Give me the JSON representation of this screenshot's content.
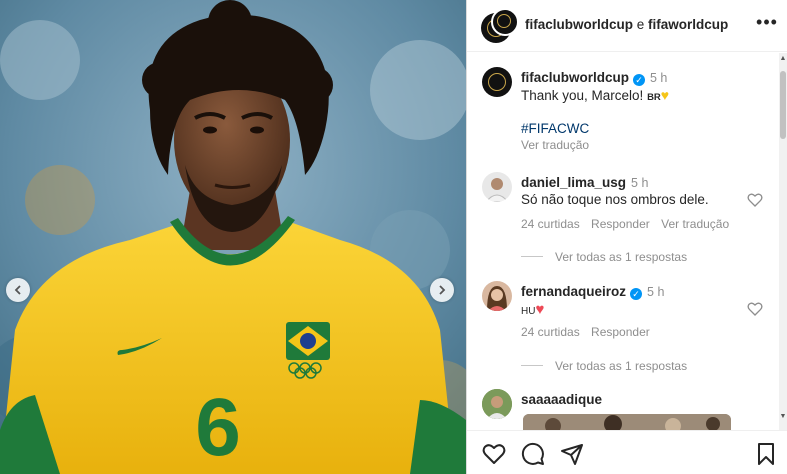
{
  "header": {
    "user_a": "fifaclubworldcup",
    "separator": " e ",
    "user_b": "fifaworldcup"
  },
  "caption": {
    "username": "fifaclubworldcup",
    "time": "5 h",
    "text": "Thank you, Marcelo! ",
    "flag": "BR",
    "hashtag": "#FIFACWC",
    "see_translation": "Ver tradução"
  },
  "comments": [
    {
      "username": "daniel_lima_usg",
      "time": "5 h",
      "text": "Só não toque nos ombros dele.",
      "likes": "24 curtidas",
      "reply": "Responder",
      "translate": "Ver tradução",
      "view_replies": "Ver todas as 1 respostas"
    },
    {
      "username": "fernandaqueiroz",
      "time": "5 h",
      "text_prefix": "HU",
      "likes": "24 curtidas",
      "reply": "Responder",
      "view_replies": "Ver todas as 1 respostas"
    },
    {
      "username": "saaaaadique"
    }
  ],
  "photo": {
    "jersey_number": "6"
  },
  "icons": {
    "like": "heart-icon",
    "comment": "comment-icon",
    "share": "share-icon",
    "save": "bookmark-icon",
    "more": "more-icon",
    "verified": "verified-icon"
  },
  "colors": {
    "verified_blue": "#0095f6",
    "jersey_yellow": "#f5c518",
    "jersey_green": "#1f7a3a",
    "heart_red": "#ed4956"
  }
}
